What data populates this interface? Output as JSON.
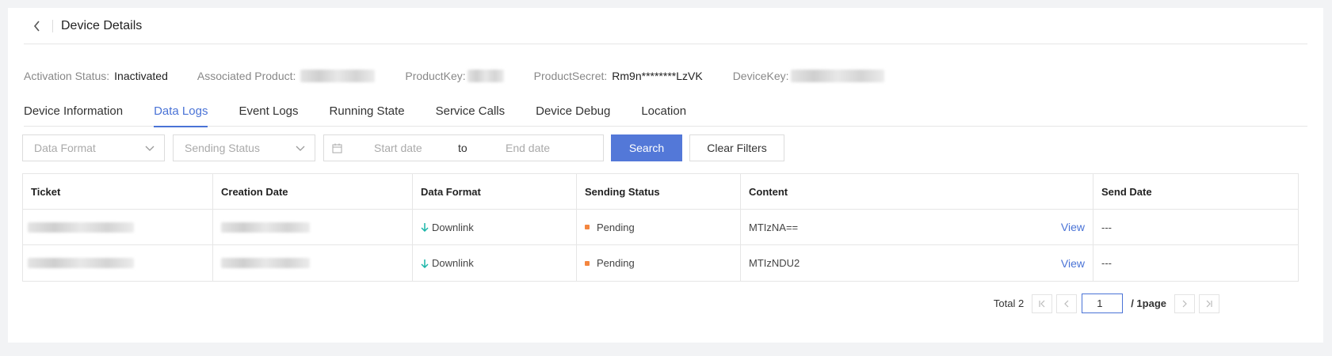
{
  "header": {
    "title": "Device Details"
  },
  "info": {
    "activation_label": "Activation Status:",
    "activation_value": "Inactivated",
    "product_label": "Associated Product:",
    "productkey_label": "ProductKey:",
    "productsecret_label": "ProductSecret:",
    "productsecret_value": "Rm9n********LzVK",
    "devicekey_label": "DeviceKey:"
  },
  "tabs": [
    {
      "label": "Device Information",
      "active": false
    },
    {
      "label": "Data Logs",
      "active": true
    },
    {
      "label": "Event Logs",
      "active": false
    },
    {
      "label": "Running State",
      "active": false
    },
    {
      "label": "Service Calls",
      "active": false
    },
    {
      "label": "Device Debug",
      "active": false
    },
    {
      "label": "Location",
      "active": false
    }
  ],
  "filters": {
    "data_format_placeholder": "Data Format",
    "sending_status_placeholder": "Sending Status",
    "start_date_placeholder": "Start date",
    "to_label": "to",
    "end_date_placeholder": "End date",
    "search_label": "Search",
    "clear_label": "Clear Filters"
  },
  "table": {
    "columns": [
      "Ticket",
      "Creation Date",
      "Data Format",
      "Sending Status",
      "Content",
      "Send Date"
    ],
    "rows": [
      {
        "data_format": "Downlink",
        "sending_status": "Pending",
        "content": "MTIzNA==",
        "action": "View",
        "send_date": "---"
      },
      {
        "data_format": "Downlink",
        "sending_status": "Pending",
        "content": "MTIzNDU2",
        "action": "View",
        "send_date": "---"
      }
    ]
  },
  "pagination": {
    "total_label": "Total 2",
    "current_page": "1",
    "pages_label": "/ 1page"
  },
  "colors": {
    "accent": "#4a73d6",
    "primary_button": "#5378d8",
    "pending": "#f4863f",
    "downlink_arrow": "#1bb5a8"
  }
}
